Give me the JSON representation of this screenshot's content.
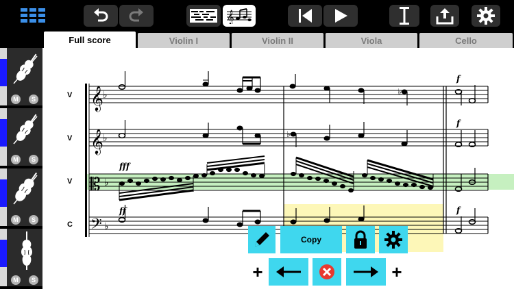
{
  "toolbar": {
    "buttons": [
      "grid-view",
      "undo",
      "redo",
      "piano-roll-view",
      "notation-view",
      "skip-to-start",
      "play",
      "text-cursor",
      "export",
      "settings"
    ]
  },
  "tabs": [
    {
      "label": "Full score",
      "active": true
    },
    {
      "label": "Violin I",
      "active": false
    },
    {
      "label": "Violin II",
      "active": false
    },
    {
      "label": "Viola",
      "active": false
    },
    {
      "label": "Cello",
      "active": false
    }
  ],
  "tracks": [
    {
      "instrument": "violin",
      "mute": "M",
      "solo": "S"
    },
    {
      "instrument": "violin",
      "mute": "M",
      "solo": "S"
    },
    {
      "instrument": "viola",
      "mute": "M",
      "solo": "S"
    },
    {
      "instrument": "cello",
      "mute": "M",
      "solo": "S"
    }
  ],
  "score": {
    "staff_labels": [
      "V",
      "V",
      "V",
      "C"
    ],
    "dynamics": {
      "viola": "fff",
      "cello": "ff",
      "violin1_m3": "f",
      "violin2_m3": "f",
      "cello_m3": "f"
    },
    "highlight_colors": {
      "selected_staff": "#c6f0c0",
      "selection": "#fdf7b8"
    }
  },
  "panel": {
    "copy_label": "Copy",
    "accent": "#3fd7ee",
    "plus_label": "+"
  }
}
